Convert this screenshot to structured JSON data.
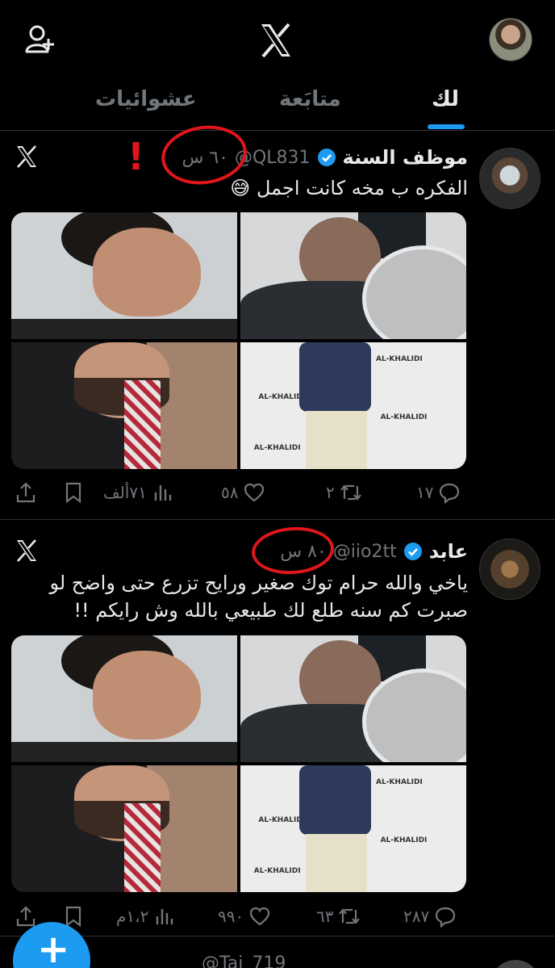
{
  "tabs": [
    {
      "label": "لك",
      "active": true
    },
    {
      "label": "متابَعة",
      "active": false
    },
    {
      "label": "عشوائيات",
      "active": false
    }
  ],
  "colors": {
    "accent": "#1d9bf0",
    "annotation": "#e0161c",
    "muted": "#71767b"
  },
  "posts": [
    {
      "name": "موظف السنة",
      "handle": "@QL831",
      "time": "٦٠ س",
      "text": "الفكره ب مخه كانت اجمل 😅",
      "annotation_mark": "!",
      "actions": {
        "reply": "١٧",
        "repost": "٢",
        "like": "٥٨",
        "views": "٧١ألف"
      }
    },
    {
      "name": "عابد",
      "handle": "@iio2tt",
      "time": "٨٠ س",
      "text": "ياخي والله حرام توك صغير ورايح تزرع حتى واضح لو صبرت كم سنه طلع لك طبيعي بالله وش رايكم !!",
      "actions": {
        "reply": "٢٨٧",
        "repost": "٦٣",
        "like": "٩٩٠",
        "views": "١،٢م"
      }
    }
  ],
  "photo_brand": "AL-KHALIDI",
  "next_post": {
    "handle_peek": "@Taj_719"
  }
}
